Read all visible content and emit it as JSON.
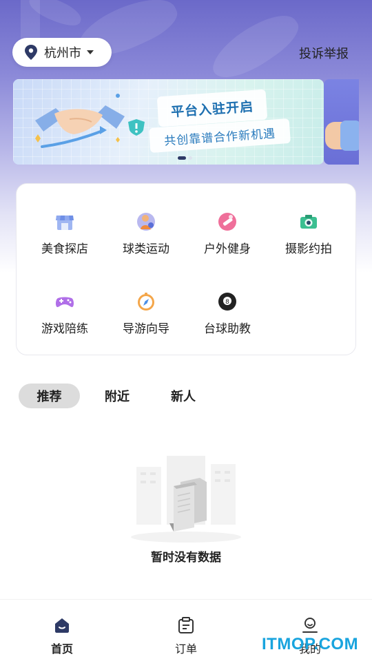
{
  "header": {
    "city": "杭州市",
    "report": "投诉举报"
  },
  "banner": {
    "title": "平台入驻开启",
    "subtitle": "共创靠谱合作新机遇",
    "slides": 2,
    "active_slide": 1
  },
  "categories": [
    {
      "label": "美食探店",
      "icon": "storefront-icon"
    },
    {
      "label": "球类运动",
      "icon": "ball-player-icon"
    },
    {
      "label": "户外健身",
      "icon": "fitness-icon"
    },
    {
      "label": "摄影约拍",
      "icon": "camera-icon"
    },
    {
      "label": "游戏陪练",
      "icon": "gamepad-icon"
    },
    {
      "label": "导游向导",
      "icon": "compass-icon"
    },
    {
      "label": "台球助教",
      "icon": "billiard-ball-icon"
    }
  ],
  "tabs": [
    {
      "label": "推荐",
      "active": true
    },
    {
      "label": "附近",
      "active": false
    },
    {
      "label": "新人",
      "active": false
    }
  ],
  "empty_state": {
    "text": "暂时没有数据"
  },
  "bottom_nav": [
    {
      "label": "首页",
      "icon": "home-icon",
      "active": true
    },
    {
      "label": "订单",
      "icon": "clipboard-icon",
      "active": false
    },
    {
      "label": "我的",
      "icon": "profile-icon",
      "active": false
    }
  ],
  "watermark": "ITMOP.COM",
  "colors": {
    "accent": "#2e3a66",
    "header_gradient_top": "#6b69c9",
    "banner_text": "#1d6fb0",
    "watermark": "#19a4de"
  }
}
